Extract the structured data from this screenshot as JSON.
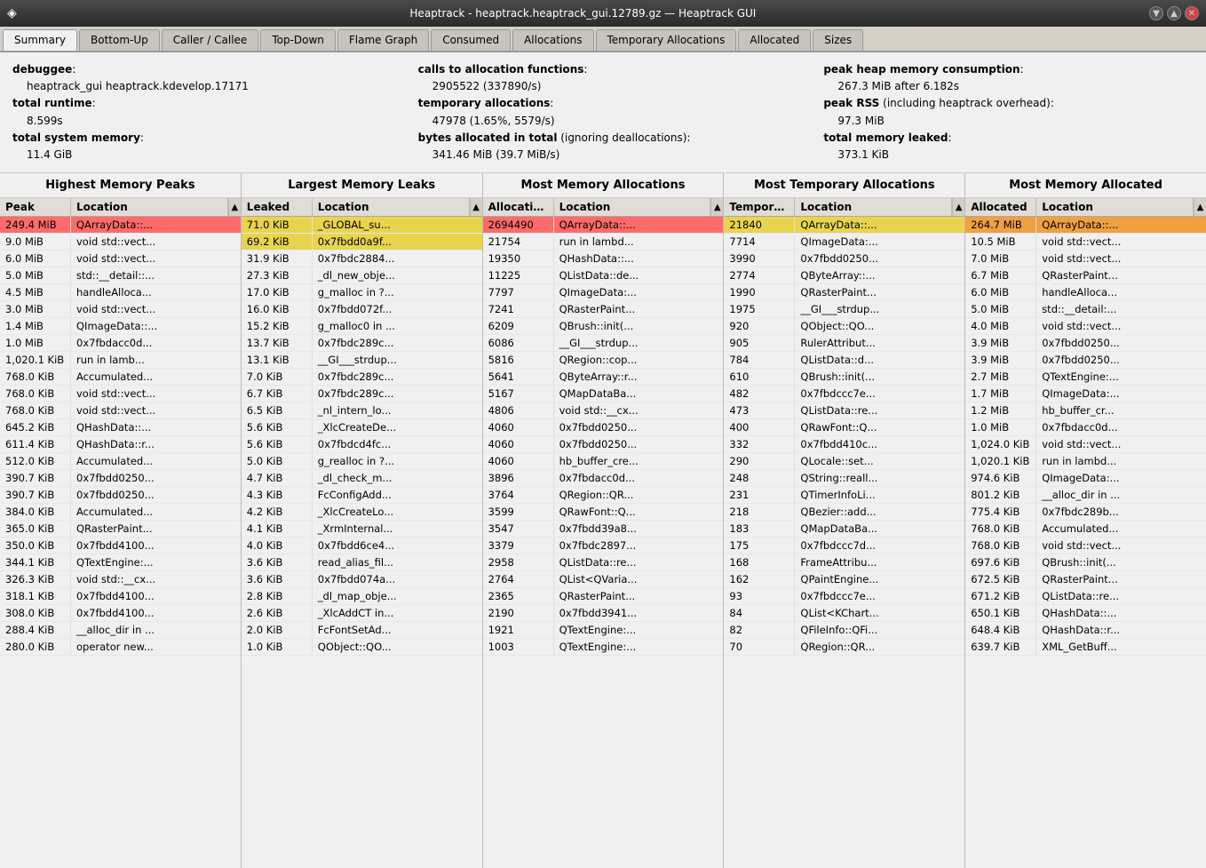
{
  "titleBar": {
    "icon": "◈",
    "title": "Heaptrack - heaptrack.heaptrack_gui.12789.gz — Heaptrack GUI",
    "controls": [
      "▼",
      "▲",
      "✕"
    ]
  },
  "tabs": [
    {
      "label": "Summary",
      "active": true
    },
    {
      "label": "Bottom-Up",
      "active": false
    },
    {
      "label": "Caller / Callee",
      "active": false
    },
    {
      "label": "Top-Down",
      "active": false
    },
    {
      "label": "Flame Graph",
      "active": false
    },
    {
      "label": "Consumed",
      "active": false
    },
    {
      "label": "Allocations",
      "active": false
    },
    {
      "label": "Temporary Allocations",
      "active": false
    },
    {
      "label": "Allocated",
      "active": false
    },
    {
      "label": "Sizes",
      "active": false
    }
  ],
  "summary": {
    "col1": {
      "debuggee_label": "debuggee",
      "debuggee_value": "heaptrack_gui heaptrack.kdevelop.17171",
      "runtime_label": "total runtime",
      "runtime_value": "8.599s",
      "memory_label": "total system memory",
      "memory_value": "11.4 GiB"
    },
    "col2": {
      "calls_label": "calls to allocation functions",
      "calls_value": "2905522 (337890/s)",
      "temp_label": "temporary allocations",
      "temp_value": "47978 (1.65%, 5579/s)",
      "bytes_label": "bytes allocated in total",
      "bytes_note": "(ignoring deallocations)",
      "bytes_value": "341.46 MiB (39.7 MiB/s)"
    },
    "col3": {
      "peak_label": "peak heap memory consumption",
      "peak_value": "267.3 MiB after 6.182s",
      "rss_label": "peak RSS",
      "rss_note": "(including heaptrack overhead)",
      "rss_value": "97.3 MiB",
      "leaked_label": "total memory leaked",
      "leaked_value": "373.1 KiB"
    }
  },
  "tables": [
    {
      "title": "Highest Memory Peaks",
      "col1": "Peak",
      "col2": "Location",
      "rows": [
        {
          "v1": "249.4 MiB",
          "v2": "QArrayData::...",
          "highlight": "red"
        },
        {
          "v1": "9.0 MiB",
          "v2": "void std::vect...",
          "highlight": ""
        },
        {
          "v1": "6.0 MiB",
          "v2": "void std::vect...",
          "highlight": ""
        },
        {
          "v1": "5.0 MiB",
          "v2": "std::__detail::...",
          "highlight": ""
        },
        {
          "v1": "4.5 MiB",
          "v2": "handleAlloca...",
          "highlight": ""
        },
        {
          "v1": "3.0 MiB",
          "v2": "void std::vect...",
          "highlight": ""
        },
        {
          "v1": "1.4 MiB",
          "v2": "QImageData::...",
          "highlight": ""
        },
        {
          "v1": "1.0 MiB",
          "v2": "0x7fbdacc0d...",
          "highlight": ""
        },
        {
          "v1": "1,020.1 KiB",
          "v2": "run in lamb...",
          "highlight": ""
        },
        {
          "v1": "768.0 KiB",
          "v2": "Accumulated...",
          "highlight": ""
        },
        {
          "v1": "768.0 KiB",
          "v2": "void std::vect...",
          "highlight": ""
        },
        {
          "v1": "768.0 KiB",
          "v2": "void std::vect...",
          "highlight": ""
        },
        {
          "v1": "645.2 KiB",
          "v2": "QHashData::...",
          "highlight": ""
        },
        {
          "v1": "611.4 KiB",
          "v2": "QHashData::r...",
          "highlight": ""
        },
        {
          "v1": "512.0 KiB",
          "v2": "Accumulated...",
          "highlight": ""
        },
        {
          "v1": "390.7 KiB",
          "v2": "0x7fbdd0250...",
          "highlight": ""
        },
        {
          "v1": "390.7 KiB",
          "v2": "0x7fbdd0250...",
          "highlight": ""
        },
        {
          "v1": "384.0 KiB",
          "v2": "Accumulated...",
          "highlight": ""
        },
        {
          "v1": "365.0 KiB",
          "v2": "QRasterPaint...",
          "highlight": ""
        },
        {
          "v1": "350.0 KiB",
          "v2": "0x7fbdd4100...",
          "highlight": ""
        },
        {
          "v1": "344.1 KiB",
          "v2": "QTextEngine:...",
          "highlight": ""
        },
        {
          "v1": "326.3 KiB",
          "v2": "void std::__cx...",
          "highlight": ""
        },
        {
          "v1": "318.1 KiB",
          "v2": "0x7fbdd4100...",
          "highlight": ""
        },
        {
          "v1": "308.0 KiB",
          "v2": "0x7fbdd4100...",
          "highlight": ""
        },
        {
          "v1": "288.4 KiB",
          "v2": "__alloc_dir in ...",
          "highlight": ""
        },
        {
          "v1": "280.0 KiB",
          "v2": "operator new...",
          "highlight": ""
        }
      ]
    },
    {
      "title": "Largest Memory Leaks",
      "col1": "Leaked",
      "col2": "Location",
      "rows": [
        {
          "v1": "71.0 KiB",
          "v2": "_GLOBAL_su...",
          "highlight": "yellow"
        },
        {
          "v1": "69.2 KiB",
          "v2": "0x7fbdd0a9f...",
          "highlight": "yellow"
        },
        {
          "v1": "31.9 KiB",
          "v2": "0x7fbdc2884...",
          "highlight": ""
        },
        {
          "v1": "27.3 KiB",
          "v2": "_dl_new_obje...",
          "highlight": ""
        },
        {
          "v1": "17.0 KiB",
          "v2": "g_malloc in ?...",
          "highlight": ""
        },
        {
          "v1": "16.0 KiB",
          "v2": "0x7fbdd072f...",
          "highlight": ""
        },
        {
          "v1": "15.2 KiB",
          "v2": "g_malloc0 in ...",
          "highlight": ""
        },
        {
          "v1": "13.7 KiB",
          "v2": "0x7fbdc289c...",
          "highlight": ""
        },
        {
          "v1": "13.1 KiB",
          "v2": "__GI___strdup...",
          "highlight": ""
        },
        {
          "v1": "7.0 KiB",
          "v2": "0x7fbdc289c...",
          "highlight": ""
        },
        {
          "v1": "6.7 KiB",
          "v2": "0x7fbdc289c...",
          "highlight": ""
        },
        {
          "v1": "6.5 KiB",
          "v2": "_nl_intern_lo...",
          "highlight": ""
        },
        {
          "v1": "5.6 KiB",
          "v2": "_XlcCreateDe...",
          "highlight": ""
        },
        {
          "v1": "5.6 KiB",
          "v2": "0x7fbdcd4fc...",
          "highlight": ""
        },
        {
          "v1": "5.0 KiB",
          "v2": "g_realloc in ?...",
          "highlight": ""
        },
        {
          "v1": "4.7 KiB",
          "v2": "_dl_check_m...",
          "highlight": ""
        },
        {
          "v1": "4.3 KiB",
          "v2": "FcConfigAdd...",
          "highlight": ""
        },
        {
          "v1": "4.2 KiB",
          "v2": "_XlcCreateLo...",
          "highlight": ""
        },
        {
          "v1": "4.1 KiB",
          "v2": "_XrmInternal...",
          "highlight": ""
        },
        {
          "v1": "4.0 KiB",
          "v2": "0x7fbdd6ce4...",
          "highlight": ""
        },
        {
          "v1": "3.6 KiB",
          "v2": "read_alias_fil...",
          "highlight": ""
        },
        {
          "v1": "3.6 KiB",
          "v2": "0x7fbdd074a...",
          "highlight": ""
        },
        {
          "v1": "2.8 KiB",
          "v2": "_dl_map_obje...",
          "highlight": ""
        },
        {
          "v1": "2.6 KiB",
          "v2": "_XlcAddCT in...",
          "highlight": ""
        },
        {
          "v1": "2.0 KiB",
          "v2": "FcFontSetAd...",
          "highlight": ""
        },
        {
          "v1": "1.0 KiB",
          "v2": "QObject::QO...",
          "highlight": ""
        }
      ]
    },
    {
      "title": "Most Memory Allocations",
      "col1": "Allocations",
      "col2": "Location",
      "rows": [
        {
          "v1": "2694490",
          "v2": "QArrayData::...",
          "highlight": "red"
        },
        {
          "v1": "21754",
          "v2": "run in lambd...",
          "highlight": ""
        },
        {
          "v1": "19350",
          "v2": "QHashData::...",
          "highlight": ""
        },
        {
          "v1": "11225",
          "v2": "QListData::de...",
          "highlight": ""
        },
        {
          "v1": "7797",
          "v2": "QImageData:...",
          "highlight": ""
        },
        {
          "v1": "7241",
          "v2": "QRasterPaint...",
          "highlight": ""
        },
        {
          "v1": "6209",
          "v2": "QBrush::init(...",
          "highlight": ""
        },
        {
          "v1": "6086",
          "v2": "__GI___strdup...",
          "highlight": ""
        },
        {
          "v1": "5816",
          "v2": "QRegion::cop...",
          "highlight": ""
        },
        {
          "v1": "5641",
          "v2": "QByteArray::r...",
          "highlight": ""
        },
        {
          "v1": "5167",
          "v2": "QMapDataBa...",
          "highlight": ""
        },
        {
          "v1": "4806",
          "v2": "void std::__cx...",
          "highlight": ""
        },
        {
          "v1": "4060",
          "v2": "0x7fbdd0250...",
          "highlight": ""
        },
        {
          "v1": "4060",
          "v2": "0x7fbdd0250...",
          "highlight": ""
        },
        {
          "v1": "4060",
          "v2": "hb_buffer_cre...",
          "highlight": ""
        },
        {
          "v1": "3896",
          "v2": "0x7fbdacc0d...",
          "highlight": ""
        },
        {
          "v1": "3764",
          "v2": "QRegion::QR...",
          "highlight": ""
        },
        {
          "v1": "3599",
          "v2": "QRawFont::Q...",
          "highlight": ""
        },
        {
          "v1": "3547",
          "v2": "0x7fbdd39a8...",
          "highlight": ""
        },
        {
          "v1": "3379",
          "v2": "0x7fbdc2897...",
          "highlight": ""
        },
        {
          "v1": "2958",
          "v2": "QListData::re...",
          "highlight": ""
        },
        {
          "v1": "2764",
          "v2": "QList<QVaria...",
          "highlight": ""
        },
        {
          "v1": "2365",
          "v2": "QRasterPaint...",
          "highlight": ""
        },
        {
          "v1": "2190",
          "v2": "0x7fbdd3941...",
          "highlight": ""
        },
        {
          "v1": "1921",
          "v2": "QTextEngine:...",
          "highlight": ""
        },
        {
          "v1": "1003",
          "v2": "QTextEngine:...",
          "highlight": ""
        }
      ]
    },
    {
      "title": "Most Temporary Allocations",
      "col1": "Temporary",
      "col2": "Location",
      "rows": [
        {
          "v1": "21840",
          "v2": "QArrayData::...",
          "highlight": "yellow"
        },
        {
          "v1": "7714",
          "v2": "QImageData:...",
          "highlight": ""
        },
        {
          "v1": "3990",
          "v2": "0x7fbdd0250...",
          "highlight": ""
        },
        {
          "v1": "2774",
          "v2": "QByteArray::...",
          "highlight": ""
        },
        {
          "v1": "1990",
          "v2": "QRasterPaint...",
          "highlight": ""
        },
        {
          "v1": "1975",
          "v2": "__GI___strdup...",
          "highlight": ""
        },
        {
          "v1": "920",
          "v2": "QObject::QO...",
          "highlight": ""
        },
        {
          "v1": "905",
          "v2": "RulerAttribut...",
          "highlight": ""
        },
        {
          "v1": "784",
          "v2": "QListData::d...",
          "highlight": ""
        },
        {
          "v1": "610",
          "v2": "QBrush::init(...",
          "highlight": ""
        },
        {
          "v1": "482",
          "v2": "0x7fbdccc7e...",
          "highlight": ""
        },
        {
          "v1": "473",
          "v2": "QListData::re...",
          "highlight": ""
        },
        {
          "v1": "400",
          "v2": "QRawFont::Q...",
          "highlight": ""
        },
        {
          "v1": "332",
          "v2": "0x7fbdd410c...",
          "highlight": ""
        },
        {
          "v1": "290",
          "v2": "QLocale::set...",
          "highlight": ""
        },
        {
          "v1": "248",
          "v2": "QString::reall...",
          "highlight": ""
        },
        {
          "v1": "231",
          "v2": "QTimerInfoLi...",
          "highlight": ""
        },
        {
          "v1": "218",
          "v2": "QBezier::add...",
          "highlight": ""
        },
        {
          "v1": "183",
          "v2": "QMapDataBa...",
          "highlight": ""
        },
        {
          "v1": "175",
          "v2": "0x7fbdccc7d...",
          "highlight": ""
        },
        {
          "v1": "168",
          "v2": "FrameAttribu...",
          "highlight": ""
        },
        {
          "v1": "162",
          "v2": "QPaintEngine...",
          "highlight": ""
        },
        {
          "v1": "93",
          "v2": "0x7fbdccc7e...",
          "highlight": ""
        },
        {
          "v1": "84",
          "v2": "QList<KChart...",
          "highlight": ""
        },
        {
          "v1": "82",
          "v2": "QFileInfo::QFi...",
          "highlight": ""
        },
        {
          "v1": "70",
          "v2": "QRegion::QR...",
          "highlight": ""
        }
      ]
    },
    {
      "title": "Most Memory Allocated",
      "col1": "Allocated",
      "col2": "Location",
      "rows": [
        {
          "v1": "264.7 MiB",
          "v2": "QArrayData::...",
          "highlight": "orange"
        },
        {
          "v1": "10.5 MiB",
          "v2": "void std::vect...",
          "highlight": ""
        },
        {
          "v1": "7.0 MiB",
          "v2": "void std::vect...",
          "highlight": ""
        },
        {
          "v1": "6.7 MiB",
          "v2": "QRasterPaint...",
          "highlight": ""
        },
        {
          "v1": "6.0 MiB",
          "v2": "handleAlloca...",
          "highlight": ""
        },
        {
          "v1": "5.0 MiB",
          "v2": "std::__detail:...",
          "highlight": ""
        },
        {
          "v1": "4.0 MiB",
          "v2": "void std::vect...",
          "highlight": ""
        },
        {
          "v1": "3.9 MiB",
          "v2": "0x7fbdd0250...",
          "highlight": ""
        },
        {
          "v1": "3.9 MiB",
          "v2": "0x7fbdd0250...",
          "highlight": ""
        },
        {
          "v1": "2.7 MiB",
          "v2": "QTextEngine:...",
          "highlight": ""
        },
        {
          "v1": "1.7 MiB",
          "v2": "QImageData:...",
          "highlight": ""
        },
        {
          "v1": "1.2 MiB",
          "v2": "hb_buffer_cr...",
          "highlight": ""
        },
        {
          "v1": "1.0 MiB",
          "v2": "0x7fbdacc0d...",
          "highlight": ""
        },
        {
          "v1": "1,024.0 KiB",
          "v2": "void std::vect...",
          "highlight": ""
        },
        {
          "v1": "1,020.1 KiB",
          "v2": "run in lambd...",
          "highlight": ""
        },
        {
          "v1": "974.6 KiB",
          "v2": "QImageData:...",
          "highlight": ""
        },
        {
          "v1": "801.2 KiB",
          "v2": "__alloc_dir in ...",
          "highlight": ""
        },
        {
          "v1": "775.4 KiB",
          "v2": "0x7fbdc289b...",
          "highlight": ""
        },
        {
          "v1": "768.0 KiB",
          "v2": "Accumulated...",
          "highlight": ""
        },
        {
          "v1": "768.0 KiB",
          "v2": "void std::vect...",
          "highlight": ""
        },
        {
          "v1": "697.6 KiB",
          "v2": "QBrush::init(...",
          "highlight": ""
        },
        {
          "v1": "672.5 KiB",
          "v2": "QRasterPaint...",
          "highlight": ""
        },
        {
          "v1": "671.2 KiB",
          "v2": "QListData::re...",
          "highlight": ""
        },
        {
          "v1": "650.1 KiB",
          "v2": "QHashData::...",
          "highlight": ""
        },
        {
          "v1": "648.4 KiB",
          "v2": "QHashData::r...",
          "highlight": ""
        },
        {
          "v1": "639.7 KiB",
          "v2": "XML_GetBuff...",
          "highlight": ""
        }
      ]
    }
  ]
}
